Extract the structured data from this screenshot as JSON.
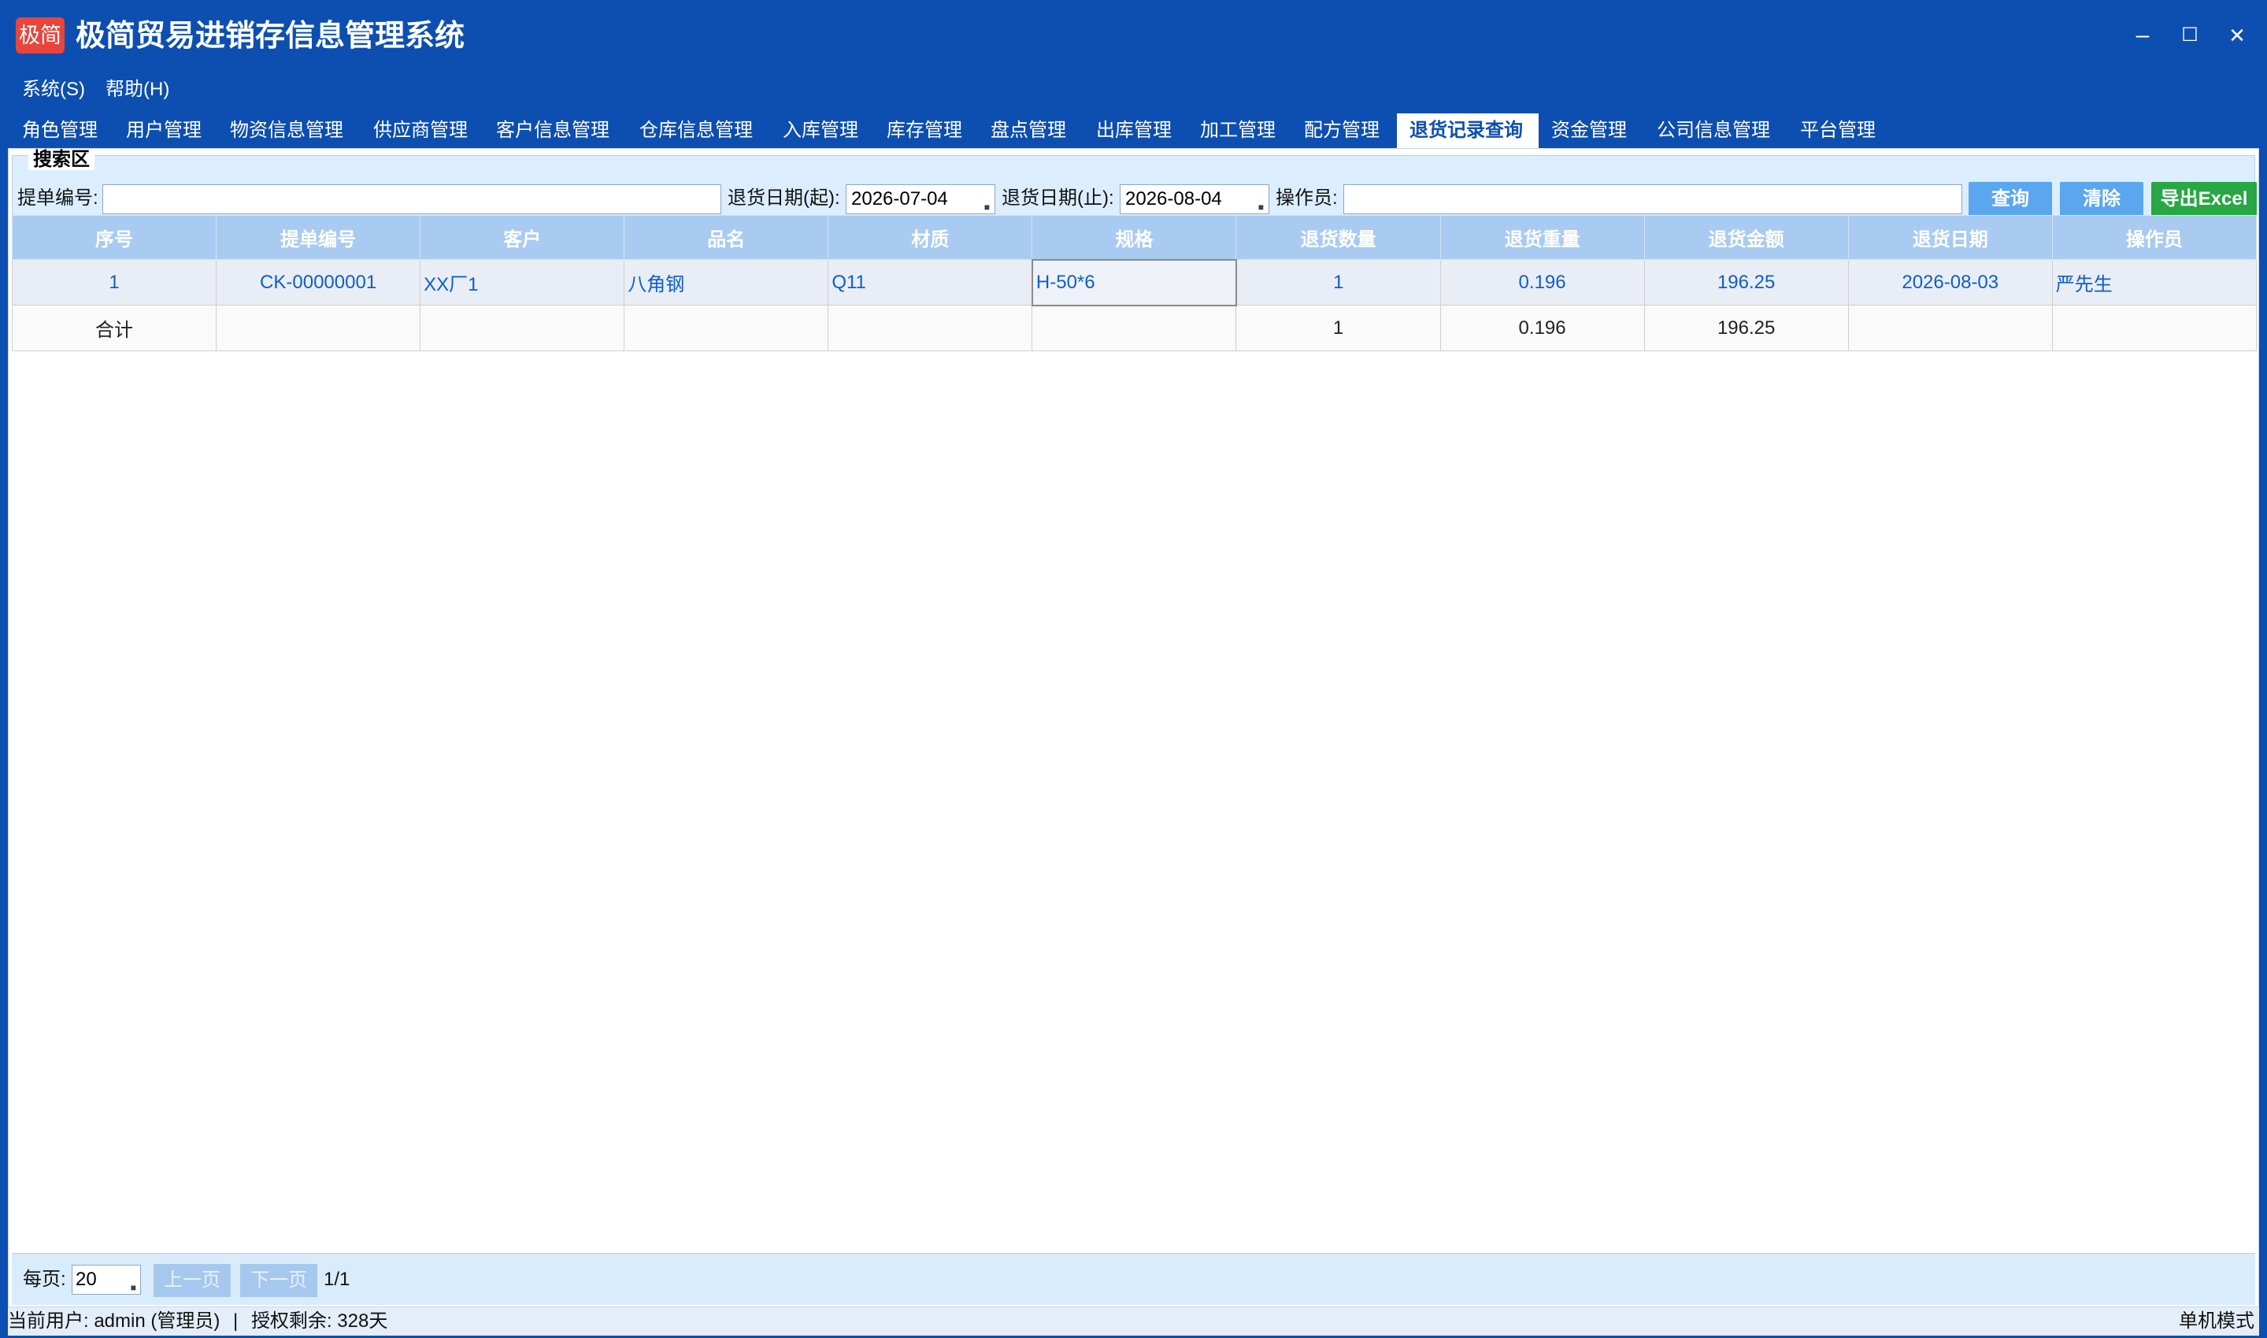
{
  "app": {
    "logo_text": "极简",
    "title": "极简贸易进销存信息管理系统"
  },
  "window_controls": {
    "minimize": "–",
    "maximize": "☐",
    "close": "✕"
  },
  "menu": [
    {
      "label": "系统(S)"
    },
    {
      "label": "帮助(H)"
    }
  ],
  "tabs": [
    "角色管理",
    "用户管理",
    "物资信息管理",
    "供应商管理",
    "客户信息管理",
    "仓库信息管理",
    "入库管理",
    "库存管理",
    "盘点管理",
    "出库管理",
    "加工管理",
    "配方管理",
    "退货记录查询",
    "资金管理",
    "公司信息管理",
    "平台管理"
  ],
  "active_tab": "退货记录查询",
  "search": {
    "legend": "搜索区",
    "order_no_label": "提单编号:",
    "order_no_value": "",
    "date_from_label": "退货日期(起):",
    "date_from_value": "2026-07-04",
    "date_to_label": "退货日期(止):",
    "date_to_value": "2026-08-04",
    "operator_label": "操作员:",
    "operator_value": "",
    "query_button": "查询",
    "clear_button": "清除",
    "export_button": "导出Excel"
  },
  "table": {
    "columns": [
      "序号",
      "提单编号",
      "客户",
      "品名",
      "材质",
      "规格",
      "退货数量",
      "退货重量",
      "退货金额",
      "退货日期",
      "操作员"
    ],
    "rows": [
      [
        "1",
        "CK-00000001",
        "XX厂1",
        "八角钢",
        "Q11",
        "H-50*6",
        "1",
        "0.196",
        "196.25",
        "2026-08-03",
        "严先生"
      ]
    ],
    "total_row": [
      "合计",
      "",
      "",
      "",
      "",
      "",
      "1",
      "0.196",
      "196.25",
      "",
      ""
    ]
  },
  "pager": {
    "per_page_label": "每页:",
    "per_page_value": "20",
    "prev_label": "上一页",
    "next_label": "下一页",
    "page_info": "1/1"
  },
  "status": {
    "user": "当前用户: admin (管理员)",
    "separator": "|",
    "license": "授权剩余: 328天",
    "mode": "单机模式"
  }
}
